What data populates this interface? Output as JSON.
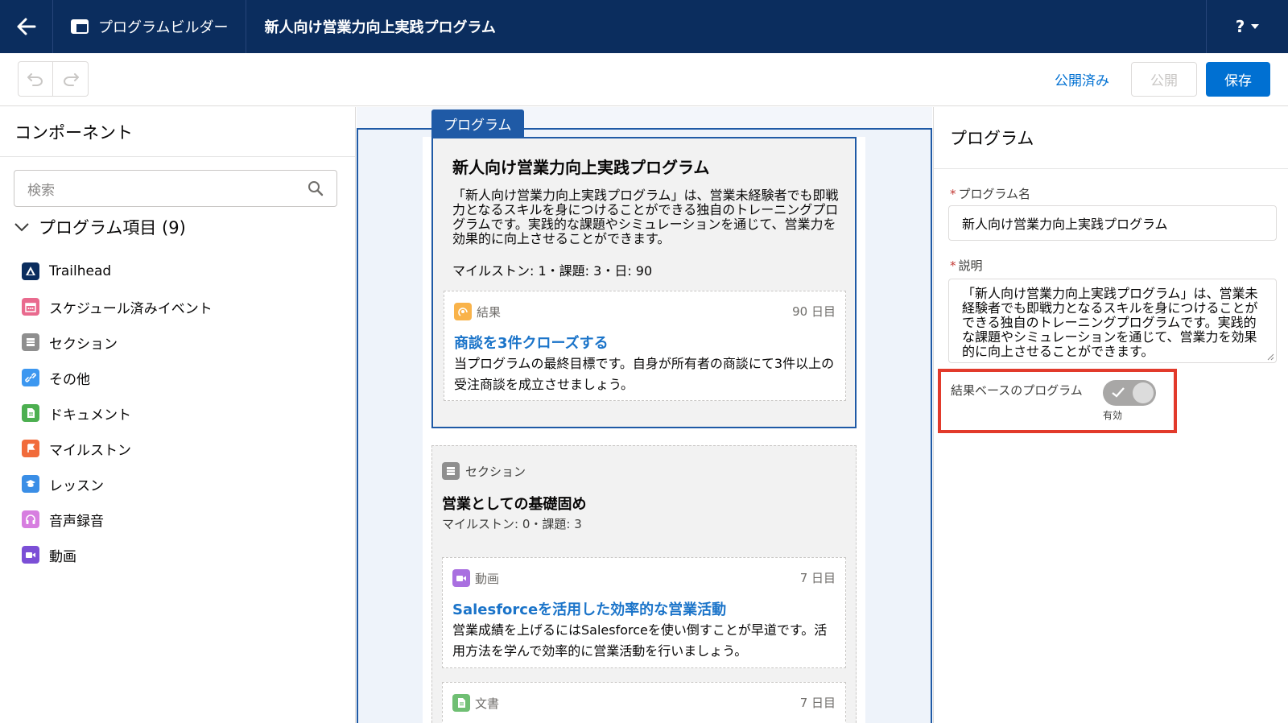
{
  "header": {
    "app_title": "プログラムビルダー",
    "program_title": "新人向け営業力向上実践プログラム",
    "help_label": "?"
  },
  "toolbar": {
    "published_label": "公開済み",
    "publish_label": "公開",
    "save_label": "保存"
  },
  "left_panel": {
    "title": "コンポーネント",
    "search_placeholder": "検索",
    "section_label": "プログラム項目 (9)",
    "items": [
      {
        "label": "Trailhead",
        "icon": "trailhead-icon",
        "color": "#0b2d5e"
      },
      {
        "label": "スケジュール済みイベント",
        "icon": "calendar-icon",
        "color": "#e96a8e"
      },
      {
        "label": "セクション",
        "icon": "section-icon",
        "color": "#8f8f8f"
      },
      {
        "label": "その他",
        "icon": "link-icon",
        "color": "#3c97f0"
      },
      {
        "label": "ドキュメント",
        "icon": "document-icon",
        "color": "#4caf50"
      },
      {
        "label": "マイルストン",
        "icon": "milestone-icon",
        "color": "#f16b3b"
      },
      {
        "label": "レッスン",
        "icon": "lesson-icon",
        "color": "#3a8ee6"
      },
      {
        "label": "音声録音",
        "icon": "headphones-icon",
        "color": "#d77ee0"
      },
      {
        "label": "動画",
        "icon": "video-icon",
        "color": "#7b4fd6"
      }
    ]
  },
  "canvas": {
    "tab_label": "プログラム",
    "program": {
      "title": "新人向け営業力向上実践プログラム",
      "description": "「新人向け営業力向上実践プログラム」は、営業未経験者でも即戦力となるスキルを身につけることができる独自のトレーニングプログラムです。実践的な課題やシミュレーションを通じて、営業力を効果的に向上させることができます。",
      "meta": "マイルストン: 1・課題: 3・日: 90",
      "outcome": {
        "type_label": "結果",
        "day_label": "90 日目",
        "link": "商談を3件クローズする",
        "description": "当プログラムの最終目標です。自身が所有者の商談にて3件以上の受注商談を成立させましょう。"
      }
    },
    "section": {
      "type_label": "セクション",
      "title": "営業としての基礎固め",
      "meta": "マイルストン: 0・課題: 3",
      "video": {
        "type_label": "動画",
        "day_label": "7 日目",
        "link": "Salesforceを活用した効率的な営業活動",
        "description": "営業成績を上げるにはSalesforceを使い倒すことが早道です。活用方法を学んで効率的に営業活動を行いましょう。"
      },
      "document": {
        "type_label": "文書",
        "day_label": "7 日目"
      }
    }
  },
  "right_panel": {
    "title": "プログラム",
    "name_label": "プログラム名",
    "name_value": "新人向け営業力向上実践プログラム",
    "desc_label": "説明",
    "desc_value": "「新人向け営業力向上実践プログラム」は、営業未経験者でも即戦力となるスキルを身につけることができる独自のトレーニングプログラムです。実践的な課題やシミュレーションを通じて、営業力を効果的に向上させることができます。",
    "toggle_label": "結果ベースのプログラム",
    "toggle_caption": "有効",
    "toggle_on": true
  },
  "colors": {
    "header_bg": "#0b2d5e",
    "accent": "#0070d2",
    "canvas_border": "#1f5aa6",
    "highlight": "#e23a2b"
  }
}
